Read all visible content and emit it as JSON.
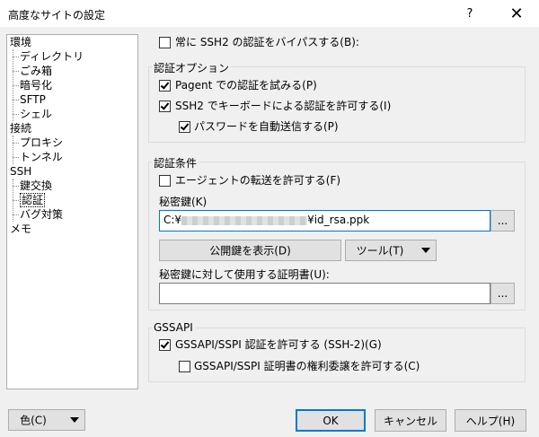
{
  "window": {
    "title": "高度なサイトの設定",
    "help_glyph": "?",
    "close_glyph": "✕"
  },
  "tree": {
    "items": [
      {
        "label": "環境"
      },
      {
        "label": "ディレクトリ"
      },
      {
        "label": "ごみ箱"
      },
      {
        "label": "暗号化"
      },
      {
        "label": "SFTP"
      },
      {
        "label": "シェル"
      },
      {
        "label": "接続"
      },
      {
        "label": "プロキシ"
      },
      {
        "label": "トンネル"
      },
      {
        "label": "SSH"
      },
      {
        "label": "鍵交換"
      },
      {
        "label": "認証",
        "selected": true
      },
      {
        "label": "バグ対策"
      },
      {
        "label": "メモ"
      }
    ]
  },
  "bypass": {
    "label": "常に SSH2 の認証をバイパスする(B):",
    "checked": false
  },
  "auth_options": {
    "title": "認証オプション",
    "pageant": {
      "label": "Pagent での認証を試みる(P)",
      "checked": true
    },
    "keyboard": {
      "label": "SSH2 でキーボードによる認証を許可する(I)",
      "checked": true
    },
    "auto_password": {
      "label": "パスワードを自動送信する(P)",
      "checked": true
    }
  },
  "auth_params": {
    "title": "認証条件",
    "agent_forward": {
      "label": "エージェントの転送を許可する(F)",
      "checked": false
    },
    "private_key_label": "秘密鍵(K)",
    "private_key_prefix": "C:¥",
    "private_key_suffix": "¥id_rsa.ppk",
    "browse_label": "...",
    "show_public_key": "公開鍵を表示(D)",
    "tools": "ツール(T)",
    "cert_label": "秘密鍵に対して使用する証明書(U):",
    "cert_value": "",
    "cert_browse_label": "..."
  },
  "gssapi": {
    "title": "GSSAPI",
    "allow": {
      "label": "GSSAPI/SSPI 認証を許可する (SSH-2)(G)",
      "checked": true
    },
    "delegation": {
      "label": "GSSAPI/SSPI 証明書の権利委譲を許可する(C)",
      "checked": false
    }
  },
  "footer": {
    "color": "色(C)",
    "ok": "OK",
    "cancel": "キャンセル",
    "help": "ヘルプ(H)"
  },
  "colors": {
    "accent": "#0078d7",
    "dialog_bg": "#f0f0f0"
  }
}
